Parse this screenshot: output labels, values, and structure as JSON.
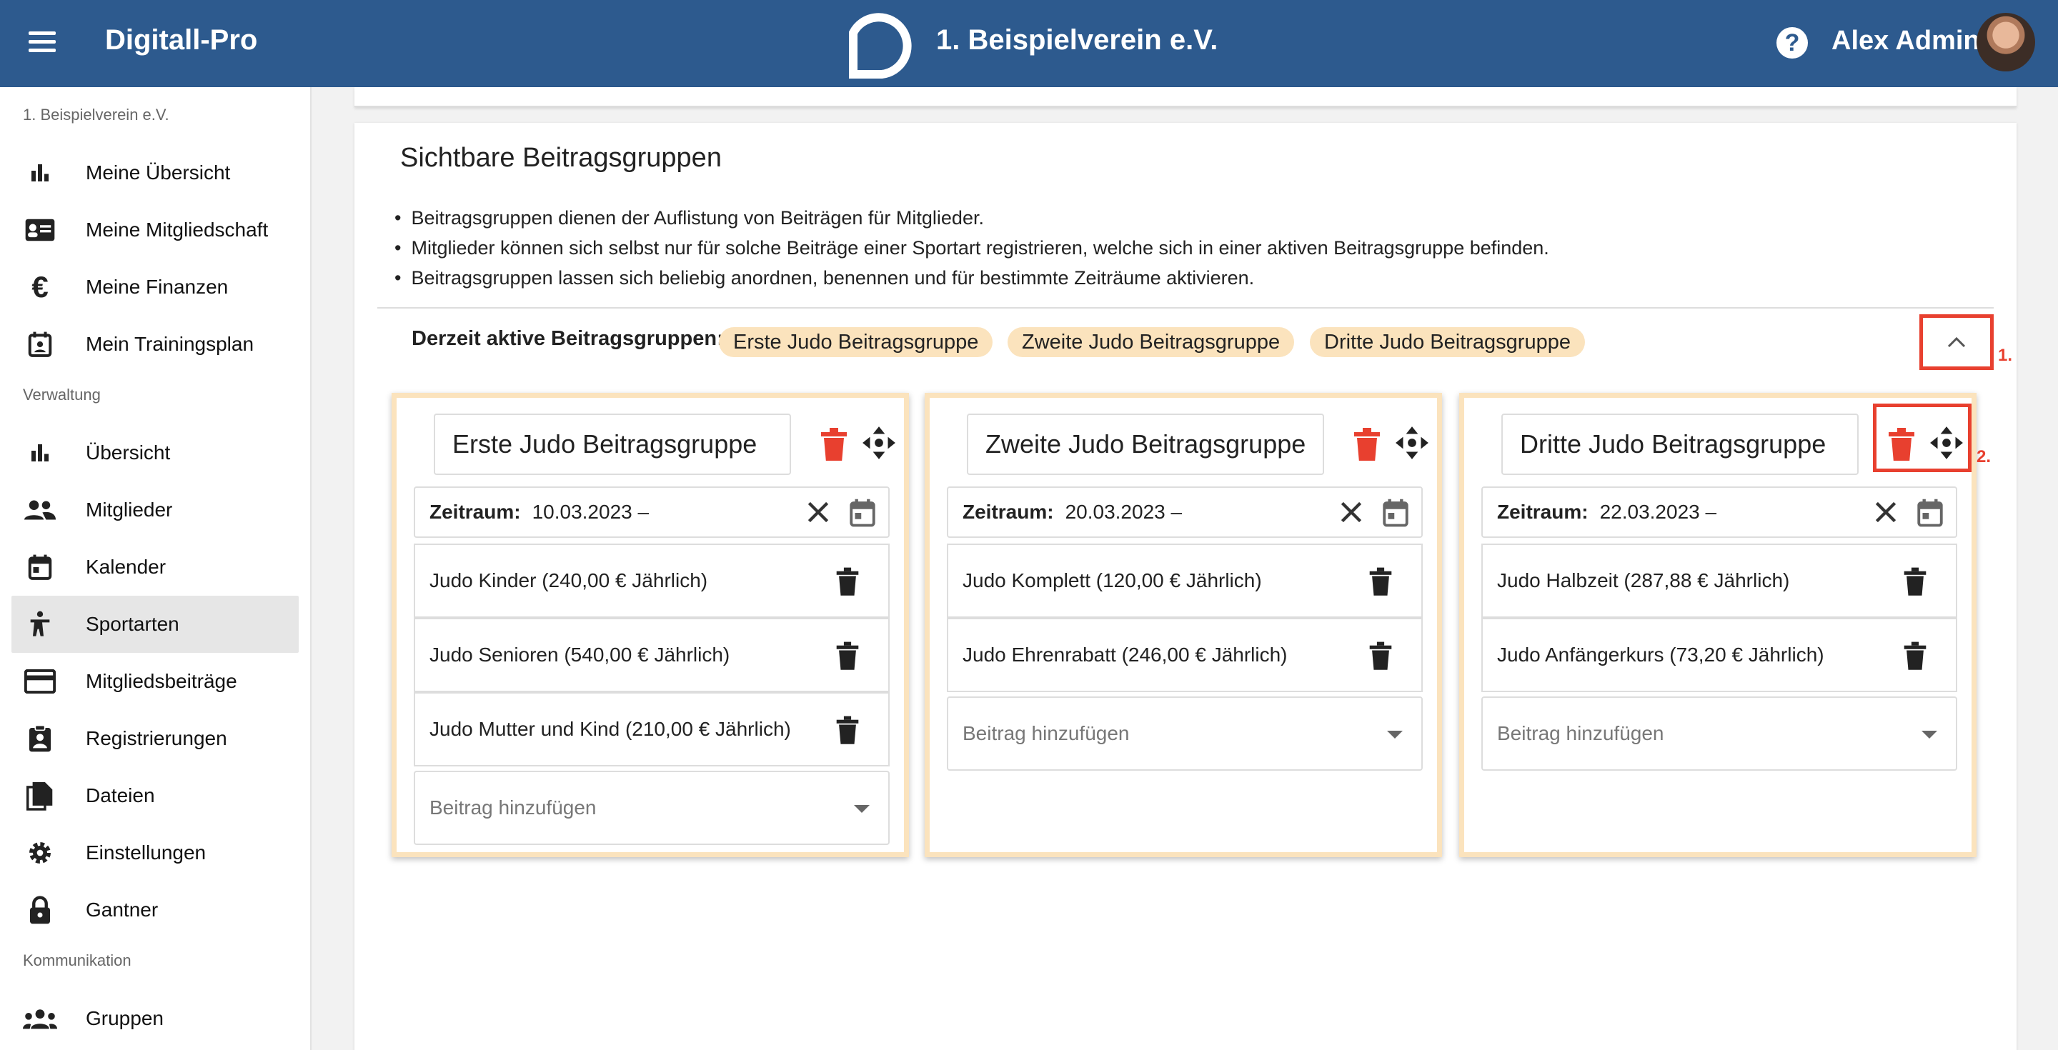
{
  "header": {
    "app_title": "Digitall-Pro",
    "club_name": "1. Beispielverein e.V.",
    "user_name": "Alex Admin",
    "help_icon": "help-icon",
    "bar_color": "#2d5a8e"
  },
  "sidebar": {
    "section_club": "1. Beispielverein e.V.",
    "section_admin": "Verwaltung",
    "section_comm": "Kommunikation",
    "items": [
      {
        "label": "Meine Übersicht",
        "icon": "bar-chart-icon"
      },
      {
        "label": "Meine Mitgliedschaft",
        "icon": "id-card-icon"
      },
      {
        "label": "Meine Finanzen",
        "icon": "euro-icon"
      },
      {
        "label": "Mein Trainingsplan",
        "icon": "calendar-person-icon"
      },
      {
        "label": "Übersicht",
        "icon": "bar-chart-icon"
      },
      {
        "label": "Mitglieder",
        "icon": "people-icon"
      },
      {
        "label": "Kalender",
        "icon": "calendar-icon"
      },
      {
        "label": "Sportarten",
        "icon": "sport-icon",
        "active": true
      },
      {
        "label": "Mitgliedsbeiträge",
        "icon": "credit-card-icon"
      },
      {
        "label": "Registrierungen",
        "icon": "clipboard-person-icon"
      },
      {
        "label": "Dateien",
        "icon": "files-icon"
      },
      {
        "label": "Einstellungen",
        "icon": "gear-icon"
      },
      {
        "label": "Gantner",
        "icon": "lock-icon"
      },
      {
        "label": "Gruppen",
        "icon": "groups-icon"
      }
    ]
  },
  "main": {
    "title": "Sichtbare Beitragsgruppen",
    "bullets": [
      "Beitragsgruppen dienen der Auflistung von Beiträgen für Mitglieder.",
      "Mitglieder können sich selbst nur für solche Beiträge einer Sportart registrieren, welche sich in einer aktiven Beitragsgruppe befinden.",
      "Beitragsgruppen lassen sich beliebig anordnen, benennen und für bestimmte Zeiträume aktivieren."
    ],
    "active_label": "Derzeit aktive Beitragsgruppen:",
    "active_chips": [
      "Erste Judo Beitragsgruppe",
      "Zweite Judo Beitragsgruppe",
      "Dritte Judo Beitragsgruppe"
    ],
    "annotation_1": "1.",
    "annotation_2": "2.",
    "range_label": "Zeitraum:",
    "add_placeholder": "Beitrag hinzufügen",
    "groups": [
      {
        "name": "Erste Judo Beitragsgruppe",
        "range": "10.03.2023 –",
        "fees": [
          "Judo Kinder (240,00 € Jährlich)",
          "Judo Senioren (540,00 € Jährlich)",
          "Judo Mutter und Kind (210,00 € Jährlich)"
        ]
      },
      {
        "name": "Zweite Judo Beitragsgruppe",
        "range": "20.03.2023 –",
        "fees": [
          "Judo Komplett (120,00 € Jährlich)",
          "Judo Ehrenrabatt (246,00 € Jährlich)"
        ]
      },
      {
        "name": "Dritte Judo Beitragsgruppe",
        "range": "22.03.2023 –",
        "fees": [
          "Judo Halbzeit (287,88 € Jährlich)",
          "Judo Anfängerkurs (73,20 € Jährlich)"
        ]
      }
    ]
  },
  "colors": {
    "accent_red": "#e8402f",
    "chip_bg": "#fbe3bd"
  }
}
